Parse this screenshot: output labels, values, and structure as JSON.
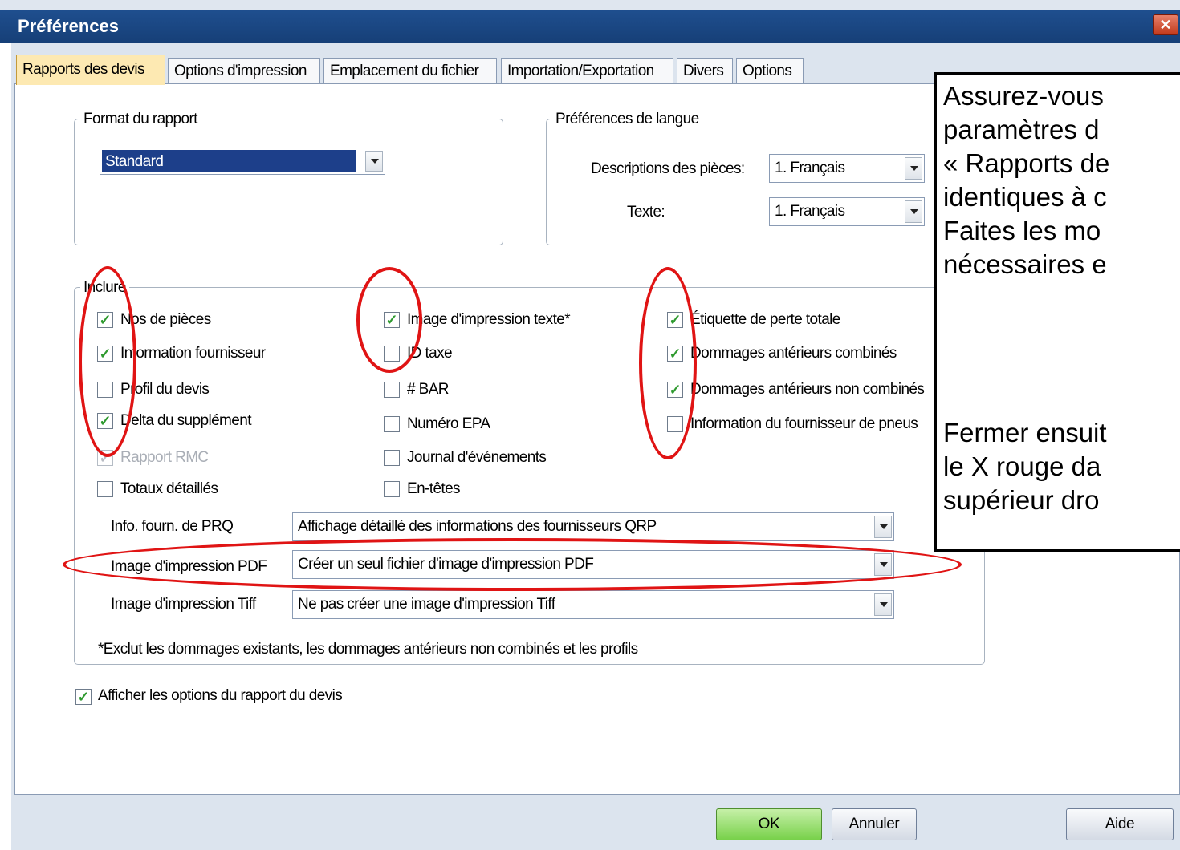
{
  "window": {
    "title": "Préférences",
    "close_glyph": "✕"
  },
  "tabs": [
    {
      "label": "Rapports des devis",
      "active": true
    },
    {
      "label": "Options d'impression"
    },
    {
      "label": "Emplacement du fichier"
    },
    {
      "label": "Importation/Exportation"
    },
    {
      "label": "Divers"
    },
    {
      "label": "Options"
    }
  ],
  "report_format": {
    "legend": "Format du rapport",
    "value": "Standard"
  },
  "language": {
    "legend": "Préférences de langue",
    "parts_label": "Descriptions des pièces:",
    "parts_value": "1. Français",
    "text_label": "Texte:",
    "text_value": "1. Français"
  },
  "include": {
    "legend": "Inclure",
    "col1": [
      {
        "label": "Nos de pièces",
        "checked": true
      },
      {
        "label": "Information fournisseur",
        "checked": true
      },
      {
        "label": "Profil du devis",
        "checked": false
      },
      {
        "label": "Delta du supplément",
        "checked": true
      },
      {
        "label": "Rapport RMC",
        "checked": true,
        "disabled": true
      },
      {
        "label": "Totaux détaillés",
        "checked": false
      }
    ],
    "col2": [
      {
        "label": "Image d'impression texte*",
        "checked": true
      },
      {
        "label": "ID taxe",
        "checked": false
      },
      {
        "label": "# BAR",
        "checked": false
      },
      {
        "label": "Numéro EPA",
        "checked": false
      },
      {
        "label": "Journal d'événements",
        "checked": false
      },
      {
        "label": "En-têtes",
        "checked": false
      }
    ],
    "col3": [
      {
        "label": "Étiquette de perte totale",
        "checked": true
      },
      {
        "label": "Dommages antérieurs combinés",
        "checked": true
      },
      {
        "label": "Dommages antérieurs non combinés",
        "checked": true
      },
      {
        "label": "Information du fournisseur de pneus",
        "checked": false
      }
    ],
    "prq_label": "Info. fourn. de PRQ",
    "prq_value": "Affichage détaillé des informations des fournisseurs QRP",
    "pdf_label": "Image d'impression PDF",
    "pdf_value": "Créer un seul fichier d'image d'impression PDF",
    "tiff_label": "Image d'impression Tiff",
    "tiff_value": "Ne pas créer une image d'impression Tiff",
    "footnote": "*Exclut les dommages existants, les dommages antérieurs non combinés et les profils"
  },
  "show_options": {
    "label": "Afficher les options du rapport du devis",
    "checked": true
  },
  "buttons": {
    "ok": "OK",
    "cancel": "Annuler",
    "help": "Aide"
  },
  "callout": {
    "lines": [
      "Assurez-vous",
      "paramètres d",
      "« Rapports de",
      "identiques à c",
      "Faites les mo",
      "nécessaires e",
      "",
      "Fermer ensuit",
      "le X rouge da",
      "supérieur dro"
    ]
  },
  "colors": {
    "annotation": "#e01414",
    "checkmark": "#2f9a2f",
    "title_bar": "#1f4f8f"
  }
}
